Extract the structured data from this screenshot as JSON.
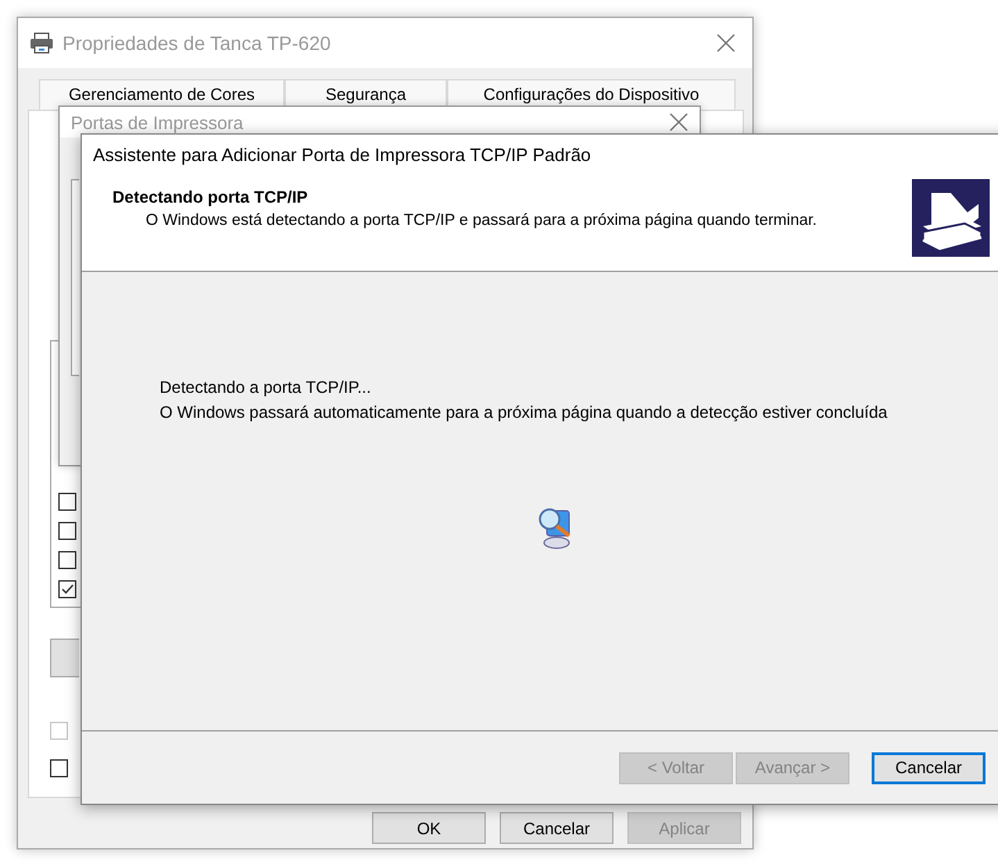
{
  "properties_window": {
    "title": "Propriedades de Tanca TP-620",
    "tabs": [
      {
        "label": "Gerenciamento de Cores"
      },
      {
        "label": "Segurança"
      },
      {
        "label": "Configurações do Dispositivo"
      }
    ],
    "checkboxes": [
      {
        "checked": false
      },
      {
        "checked": false
      },
      {
        "checked": false
      },
      {
        "checked": true
      }
    ],
    "bottom_checkboxes": [
      {
        "checked": false,
        "disabled": true
      },
      {
        "checked": false,
        "disabled": false
      }
    ],
    "buttons": [
      {
        "label": "OK",
        "disabled": false
      },
      {
        "label": "Cancelar",
        "disabled": false
      },
      {
        "label": "Aplicar",
        "disabled": true
      }
    ]
  },
  "ports_window": {
    "title": "Portas de Impressora"
  },
  "wizard": {
    "title": "Assistente para Adicionar Porta de Impressora TCP/IP Padrão",
    "heading": "Detectando porta TCP/IP",
    "subtitle": "O Windows está detectando a porta TCP/IP e passará para a próxima página quando terminar.",
    "messages": [
      "Detectando a porta TCP/IP...",
      "O Windows passará automaticamente para a próxima página quando a detecção estiver concluída"
    ],
    "buttons": [
      {
        "label": "< Voltar",
        "disabled": true,
        "focused": false
      },
      {
        "label": "Avançar >",
        "disabled": true,
        "focused": false
      },
      {
        "label": "Cancelar",
        "disabled": false,
        "focused": true
      }
    ]
  }
}
